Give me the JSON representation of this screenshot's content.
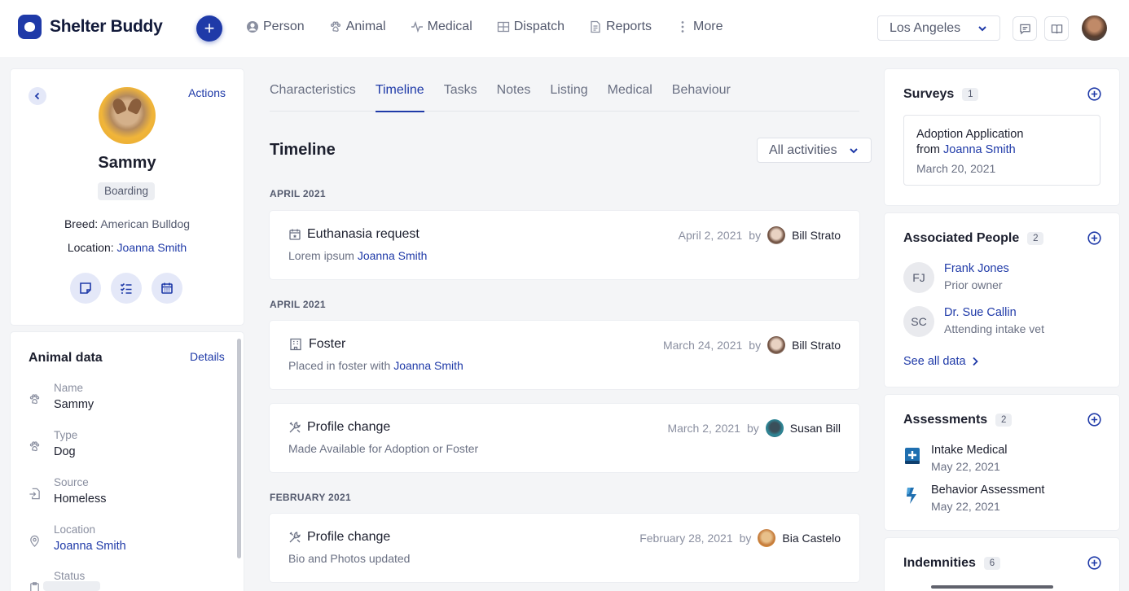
{
  "app": {
    "name": "Shelter Buddy"
  },
  "nav": {
    "items": [
      {
        "label": "Person",
        "icon": "person-icon"
      },
      {
        "label": "Animal",
        "icon": "paw-icon"
      },
      {
        "label": "Medical",
        "icon": "pulse-icon"
      },
      {
        "label": "Dispatch",
        "icon": "grid-icon"
      },
      {
        "label": "Reports",
        "icon": "document-icon"
      },
      {
        "label": "More",
        "icon": "more-vertical-icon"
      }
    ],
    "location": "Los Angeles"
  },
  "profile": {
    "actions_label": "Actions",
    "name": "Sammy",
    "status": "Boarding",
    "breed_label": "Breed:",
    "breed": "American Bulldog",
    "location_label": "Location:",
    "location": "Joanna Smith"
  },
  "animal_data": {
    "title": "Animal data",
    "details_label": "Details",
    "fields": [
      {
        "key": "Name",
        "value": "Sammy",
        "icon": "paw-icon"
      },
      {
        "key": "Type",
        "value": "Dog",
        "icon": "paw-icon"
      },
      {
        "key": "Source",
        "value": "Homeless",
        "icon": "import-icon"
      },
      {
        "key": "Location",
        "value": "Joanna Smith",
        "icon": "map-pin-icon"
      },
      {
        "key": "Status",
        "value": "",
        "icon": "clipboard-icon"
      }
    ]
  },
  "tabs": [
    {
      "label": "Characteristics",
      "active": false
    },
    {
      "label": "Timeline",
      "active": true
    },
    {
      "label": "Tasks",
      "active": false
    },
    {
      "label": "Notes",
      "active": false
    },
    {
      "label": "Listing",
      "active": false
    },
    {
      "label": "Medical",
      "active": false
    },
    {
      "label": "Behaviour",
      "active": false
    }
  ],
  "timeline": {
    "title": "Timeline",
    "filter": "All activities",
    "by": "by",
    "groups": [
      {
        "month": "APRIL 2021"
      },
      {
        "month": "APRIL 2021"
      },
      {
        "month": "FEBRUARY 2021"
      }
    ],
    "events": [
      {
        "title": "Euthanasia request",
        "desc_prefix": "Lorem ipsum",
        "desc_link": "Joanna Smith",
        "date": "April 2, 2021",
        "user": "Bill Strato",
        "icon": "calendar-star-icon"
      },
      {
        "title": "Foster",
        "desc_prefix": "Placed in foster with",
        "desc_link": "Joanna Smith",
        "date": "March 24, 2021",
        "user": "Bill Strato",
        "icon": "building-icon"
      },
      {
        "title": "Profile change",
        "desc_prefix": "Made Available for Adoption or Foster",
        "desc_link": "",
        "date": "March 2, 2021",
        "user": "Susan Bill",
        "icon": "tools-icon"
      },
      {
        "title": "Profile change",
        "desc_prefix": "Bio and Photos updated",
        "desc_link": "",
        "date": "February 28, 2021",
        "user": "Bia Castelo",
        "icon": "tools-icon"
      }
    ]
  },
  "surveys": {
    "title": "Surveys",
    "count": "1",
    "item": {
      "line1": "Adoption Application",
      "from": "from",
      "person": "Joanna Smith",
      "date": "March 20, 2021"
    }
  },
  "associated_people": {
    "title": "Associated People",
    "count": "2",
    "people": [
      {
        "initials": "FJ",
        "name": "Frank Jones",
        "role": "Prior owner"
      },
      {
        "initials": "SC",
        "name": "Dr. Sue Callin",
        "role": "Attending intake vet"
      }
    ],
    "see_all": "See all data"
  },
  "assessments": {
    "title": "Assessments",
    "count": "2",
    "items": [
      {
        "name": "Intake Medical",
        "date": "May 22, 2021",
        "icon": "medical-plus-icon"
      },
      {
        "name": "Behavior Assessment",
        "date": "May 22, 2021",
        "icon": "lightning-icon"
      }
    ]
  },
  "indemnities": {
    "title": "Indemnities",
    "count": "6"
  },
  "colors": {
    "accent": "#1f3aa8",
    "text": "#1c1f2e",
    "muted": "#6a7083",
    "background": "#f4f5f7"
  }
}
